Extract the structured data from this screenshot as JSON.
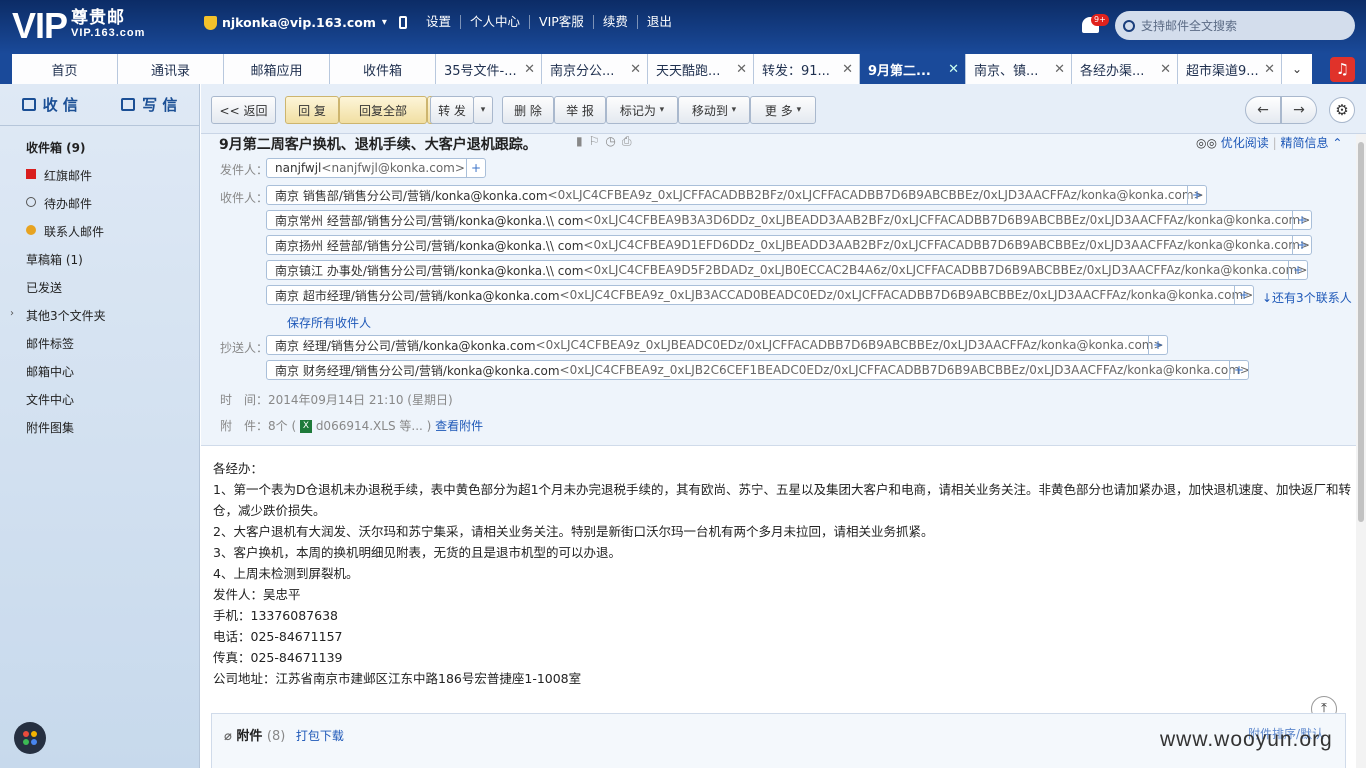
{
  "logo": {
    "vip": "VIP",
    "cn": "尊贵邮",
    "url": "VIP.163.com"
  },
  "user": {
    "email": "njkonka@vip.163.com"
  },
  "top_links": [
    "设置",
    "个人中心",
    "VIP客服",
    "续费",
    "退出"
  ],
  "notif": {
    "count": "9+"
  },
  "search": {
    "placeholder": "支持邮件全文搜索"
  },
  "tabs": [
    "首页",
    "通讯录",
    "邮箱应用",
    "收件箱",
    "35号文件-...",
    "南京分公...",
    "天天酷跑...",
    "转发：91...",
    "9月第二...",
    "南京、镇...",
    "各经办渠...",
    "超市渠道9..."
  ],
  "sidebar": {
    "receive": "收 信",
    "write": "写 信",
    "items": [
      "收件箱 (9)",
      "红旗邮件",
      "待办邮件",
      "联系人邮件",
      "草稿箱 (1)",
      "已发送",
      "其他3个文件夹",
      "邮件标签",
      "邮箱中心",
      "文件中心",
      "附件图集"
    ]
  },
  "toolbar": {
    "back": "<< 返回",
    "reply": "回 复",
    "reply_all": "回复全部",
    "forward": "转 发",
    "delete": "删 除",
    "report": "举 报",
    "mark_as": "标记为",
    "move_to": "移动到",
    "more": "更 多"
  },
  "mail": {
    "subject": "9月第二周客户换机、退机手续、大客户退机跟踪。",
    "optimize_read": "优化阅读",
    "brief_info": "精简信息",
    "from_label": "发件人：",
    "from_name": "nanjfwjl",
    "from_addr": "<nanjfwjl@konka.com>",
    "to_label": "收件人：",
    "to": [
      {
        "name": "南京 销售部/销售分公司/营销/konka@konka.com",
        "addr": "<0xLJC4CFBEA9z_0xLJCFFACADBB2BFz/0xLJCFFACADBB7D6B9ABCBBEz/0xLJD3AACFFAz/konka@konka.com>"
      },
      {
        "name": "南京常州 经营部/销售分公司/营销/konka@konka.\\\\ com",
        "addr": "<0xLJC4CFBEA9B3A3D6DDz_0xLJBEADD3AAB2BFz/0xLJCFFACADBB7D6B9ABCBBEz/0xLJD3AACFFAz/konka@konka.com>"
      },
      {
        "name": "南京扬州 经营部/销售分公司/营销/konka@konka.\\\\ com",
        "addr": "<0xLJC4CFBEA9D1EFD6DDz_0xLJBEADD3AAB2BFz/0xLJCFFACADBB7D6B9ABCBBEz/0xLJD3AACFFAz/konka@konka.com>"
      },
      {
        "name": "南京镇江 办事处/销售分公司/营销/konka@konka.\\\\ com",
        "addr": "<0xLJC4CFBEA9D5F2BDADz_0xLJB0ECCAC2B4A6z/0xLJCFFACADBB7D6B9ABCBBEz/0xLJD3AACFFAz/konka@konka.com>"
      },
      {
        "name": "南京 超市经理/销售分公司/营销/konka@konka.com",
        "addr": "<0xLJC4CFBEA9z_0xLJB3ACCAD0BEADC0EDz/0xLJCFFACADBB7D6B9ABCBBEz/0xLJD3AACFFAz/konka@konka.com>"
      }
    ],
    "more_recipients": "↓还有3个联系人",
    "save_all": "保存所有收件人",
    "cc_label": "抄送人：",
    "cc": [
      {
        "name": "南京 经理/销售分公司/营销/konka@konka.com",
        "addr": "<0xLJC4CFBEA9z_0xLJBEADC0EDz/0xLJCFFACADBB7D6B9ABCBBEz/0xLJD3AACFFAz/konka@konka.com>"
      },
      {
        "name": "南京 财务经理/销售分公司/营销/konka@konka.com",
        "addr": "<0xLJC4CFBEA9z_0xLJB2C6CEF1BEADC0EDz/0xLJCFFACADBB7D6B9ABCBBEz/0xLJD3AACFFAz/konka@konka.com>"
      }
    ],
    "time_label": "时　间：",
    "time": "2014年09月14日 21:10 (星期日)",
    "attach_label": "附　件：",
    "attach_count": "8个 (",
    "attach_file": "d066914.XLS 等... )",
    "view_attach": "查看附件",
    "body": [
      "各经办：",
      "1、第一个表为D仓退机未办退税手续，表中黄色部分为超1个月未办完退税手续的，其有欧尚、苏宁、五星以及集团大客户和电商，请相关业务关注。非黄色部分也请加紧办退，加快退机速度、加快返厂和转仓，减少跌价损失。",
      "2、大客户退机有大润发、沃尔玛和苏宁集采，请相关业务关注。特别是新街口沃尔玛一台机有两个多月未拉回，请相关业务抓紧。",
      "3、客户换机，本周的换机明细见附表，无货的且是退市机型的可以办退。",
      "4、上周未检测到屏裂机。",
      "发件人：吴忠平",
      "手机：13376087638",
      "电话：025-84671157",
      "传真：025-84671139",
      "公司地址：江苏省南京市建邺区江东中路186号宏普捷座1-1008室"
    ]
  },
  "attachments": {
    "title": "附件",
    "count": "(8)",
    "download": "打包下载",
    "sort": "附件排序/默认"
  },
  "watermark": "www.wooyun.org"
}
